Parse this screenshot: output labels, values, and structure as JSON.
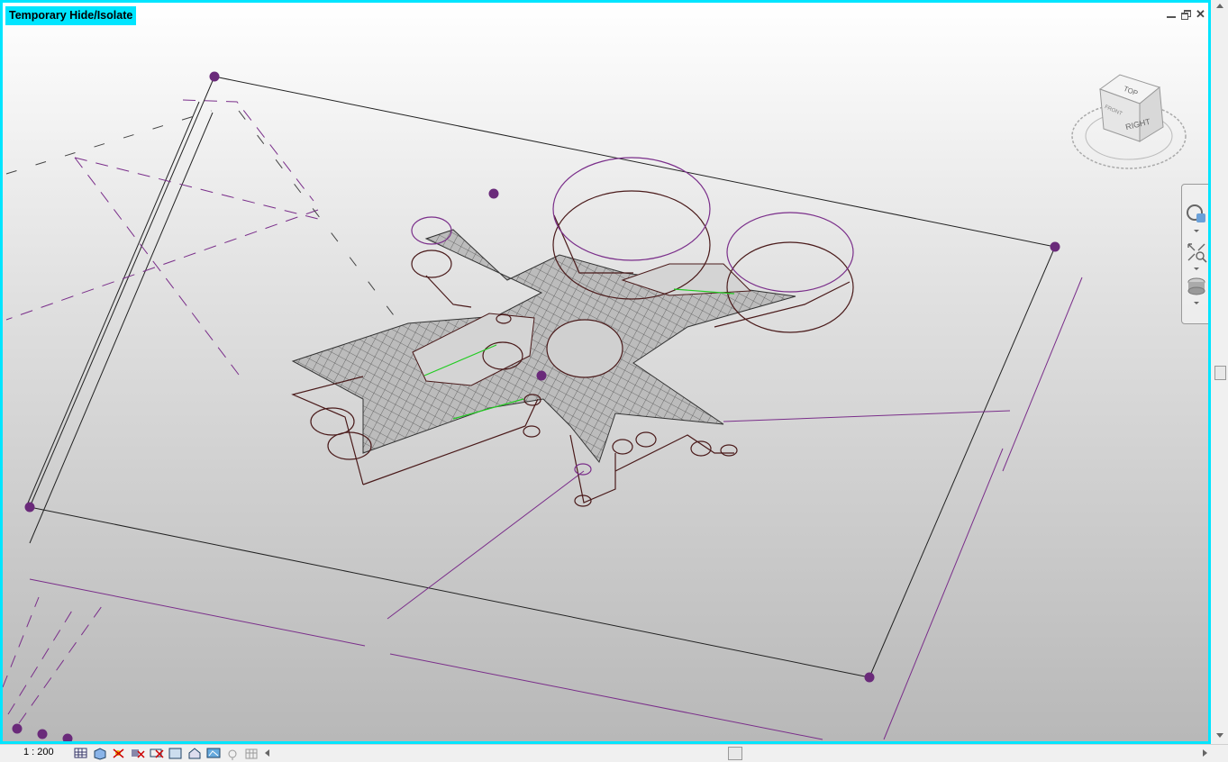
{
  "view": {
    "mode_label": "Temporary Hide/Isolate",
    "scale": "1 : 200"
  },
  "viewcube": {
    "face_top": "TOP",
    "face_right": "RIGHT",
    "face_front": "FRONT"
  },
  "navigation_bar": {
    "tools": [
      "steering-wheel-icon",
      "zoom-region-icon",
      "orbit-icon"
    ]
  },
  "status_icons": [
    "detail-level-icon",
    "visual-style-icon",
    "sun-path-icon",
    "shadows-icon",
    "crop-view-icon",
    "show-crop-region-icon",
    "unlock-3d-view-icon",
    "temporary-hide-isolate-icon",
    "reveal-hidden-elements-icon",
    "analytical-model-icon",
    "highlight-displacement-icon"
  ],
  "colors": {
    "highlight_border": "#00e5ff",
    "reference_purple": "#7a2e8a",
    "model_line": "#4a1a1a",
    "green_line": "#22cc22"
  }
}
